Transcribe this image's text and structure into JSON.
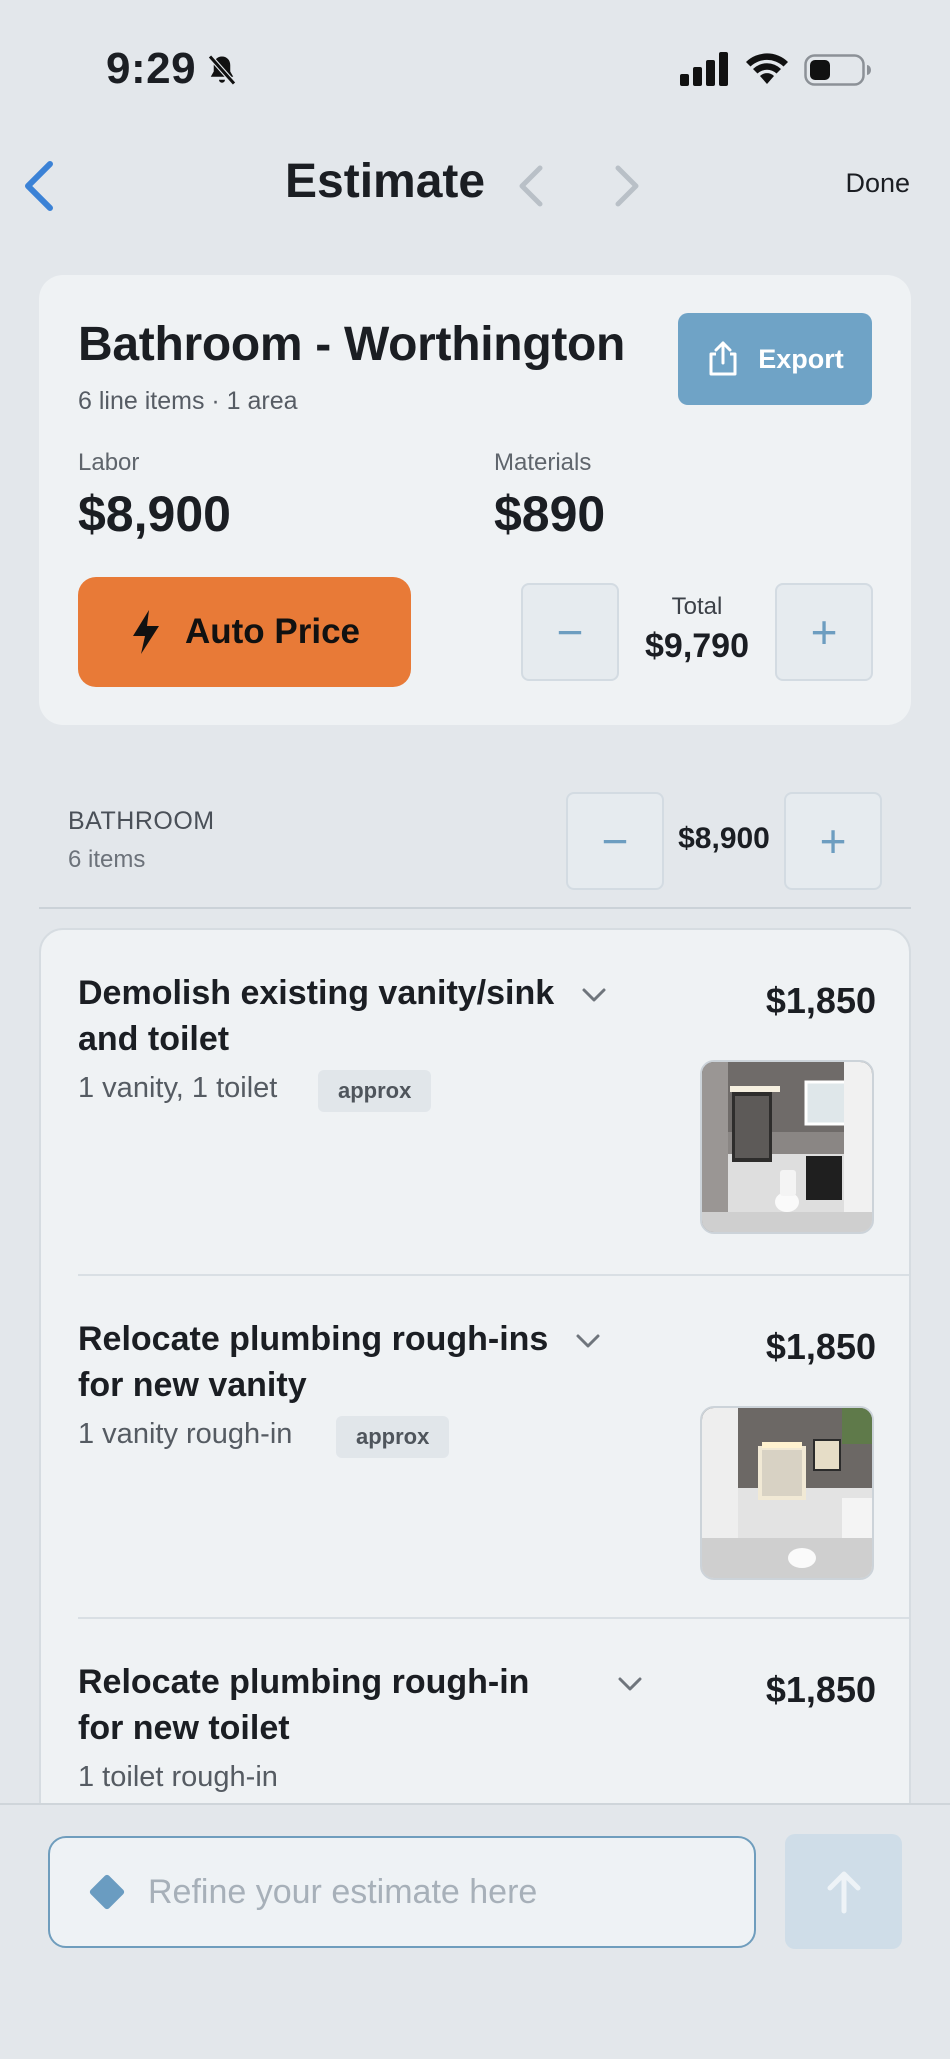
{
  "status_bar": {
    "time": "9:29"
  },
  "nav": {
    "title": "Estimate",
    "done_label": "Done"
  },
  "summary": {
    "title": "Bathroom - Worthington",
    "subtitle": "6 line items · 1 area",
    "export_label": "Export",
    "labor_label": "Labor",
    "labor_value": "$8,900",
    "materials_label": "Materials",
    "materials_value": "$890",
    "auto_price_label": "Auto Price",
    "total_label": "Total",
    "total_value": "$9,790",
    "minus_symbol": "−",
    "plus_symbol": "+"
  },
  "section": {
    "name": "BATHROOM",
    "count": "6 items",
    "value": "$8,900"
  },
  "items": [
    {
      "title": "Demolish existing vanity/sink and toilet",
      "price": "$1,850",
      "detail": "1 vanity, 1 toilet",
      "badge": "approx"
    },
    {
      "title": "Relocate plumbing rough-ins for new vanity",
      "price": "$1,850",
      "detail": "1 vanity rough-in",
      "badge": "approx"
    },
    {
      "title": "Relocate plumbing rough-in for new toilet",
      "price": "$1,850",
      "detail": "1 toilet rough-in"
    }
  ],
  "composer": {
    "placeholder": "Refine your estimate here"
  },
  "colors": {
    "accent": "#6fa3c6",
    "auto_price": "#e87a37",
    "background": "#e3e7eb",
    "card": "#eff2f4",
    "nav_back": "#3b82d6"
  }
}
